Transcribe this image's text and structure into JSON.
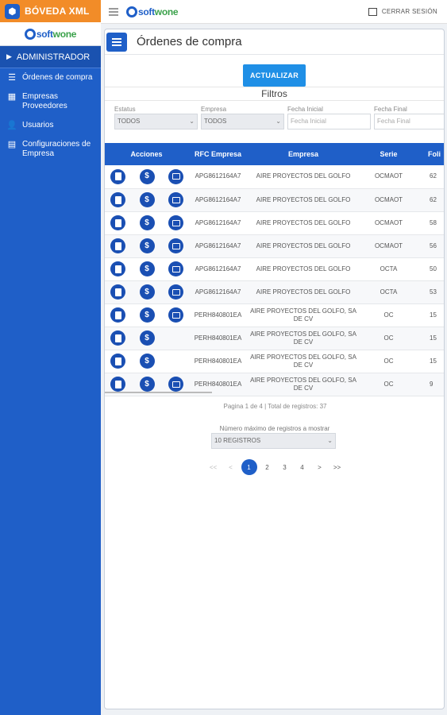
{
  "app": {
    "name": "BÓVEDA XML",
    "logo_text_a": "soft",
    "logo_text_b": "wone"
  },
  "sidebar": {
    "section": "ADMINISTRADOR",
    "items": [
      {
        "label": "Órdenes de compra",
        "icon": "list-icon"
      },
      {
        "label": "Empresas Proveedores",
        "icon": "grid-icon"
      },
      {
        "label": "Usuarios",
        "icon": "user-icon"
      },
      {
        "label": "Configuraciones de Empresa",
        "icon": "building-icon"
      }
    ]
  },
  "topbar": {
    "logout": "CERRAR SESIÓN"
  },
  "page": {
    "title": "Órdenes de compra",
    "update_button": "ACTUALIZAR",
    "filters_title": "Filtros"
  },
  "filters": {
    "estatus_label": "Estatus",
    "estatus_value": "TODOS",
    "empresa_label": "Empresa",
    "empresa_value": "TODOS",
    "fecha_inicial_label": "Fecha Inicial",
    "fecha_inicial_placeholder": "Fecha Inicial",
    "fecha_final_label": "Fecha Final",
    "fecha_final_placeholder": "Fecha Final"
  },
  "table": {
    "headers": [
      "Acciones",
      "RFC Empresa",
      "Empresa",
      "Serie",
      "Foli"
    ],
    "rows": [
      {
        "rfc": "APG8612164A7",
        "empresa": "AIRE PROYECTOS DEL GOLFO",
        "serie": "OCMAOT",
        "folio": "62",
        "third": true
      },
      {
        "rfc": "APG8612164A7",
        "empresa": "AIRE PROYECTOS DEL GOLFO",
        "serie": "OCMAOT",
        "folio": "62",
        "third": true
      },
      {
        "rfc": "APG8612164A7",
        "empresa": "AIRE PROYECTOS DEL GOLFO",
        "serie": "OCMAOT",
        "folio": "58",
        "third": true
      },
      {
        "rfc": "APG8612164A7",
        "empresa": "AIRE PROYECTOS DEL GOLFO",
        "serie": "OCMAOT",
        "folio": "56",
        "third": true
      },
      {
        "rfc": "APG8612164A7",
        "empresa": "AIRE PROYECTOS DEL GOLFO",
        "serie": "OCTA",
        "folio": "50",
        "third": true
      },
      {
        "rfc": "APG8612164A7",
        "empresa": "AIRE PROYECTOS DEL GOLFO",
        "serie": "OCTA",
        "folio": "53",
        "third": true
      },
      {
        "rfc": "PERH840801EA",
        "empresa": "AIRE PROYECTOS DEL GOLFO, SA DE CV",
        "serie": "OC",
        "folio": "15",
        "third": true
      },
      {
        "rfc": "PERH840801EA",
        "empresa": "AIRE PROYECTOS DEL GOLFO, SA DE CV",
        "serie": "OC",
        "folio": "15",
        "third": false
      },
      {
        "rfc": "PERH840801EA",
        "empresa": "AIRE PROYECTOS DEL GOLFO, SA DE CV",
        "serie": "OC",
        "folio": "15",
        "third": false
      },
      {
        "rfc": "PERH840801EA",
        "empresa": "AIRE PROYECTOS DEL GOLFO, SA DE CV",
        "serie": "OC",
        "folio": "9",
        "third": true
      }
    ]
  },
  "pagination": {
    "info": "Pagina 1 de 4 | Total de registros: 37",
    "max_label": "Número máximo de registros a mostrar",
    "max_value": "10 REGISTROS",
    "first": "<<",
    "prev": "<",
    "pages": [
      "1",
      "2",
      "3",
      "4"
    ],
    "next": ">",
    "last": ">>"
  }
}
